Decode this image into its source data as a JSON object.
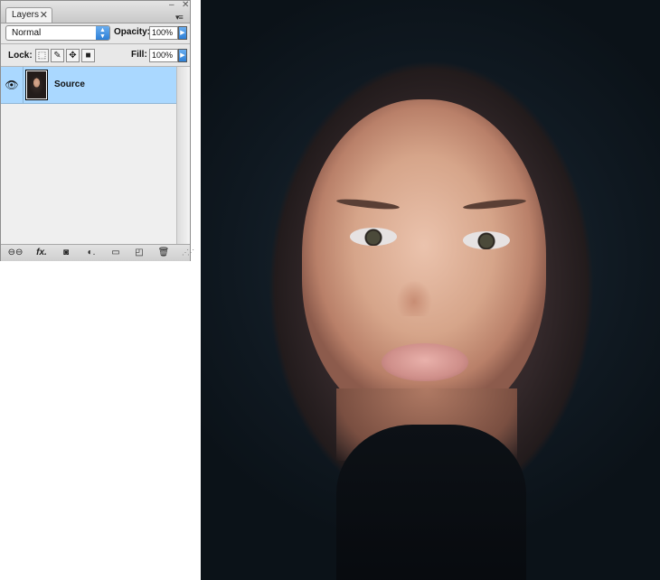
{
  "layers_panel": {
    "tab_label": "Layers",
    "tab_close": "✕",
    "minimize_glyph": "–",
    "close_glyph": "✕",
    "panel_menu_glyph": "▾≡",
    "blend_mode": "Normal",
    "opacity_label": "Opacity:",
    "opacity_value": "100%",
    "lock_label": "Lock:",
    "fill_label": "Fill:",
    "fill_value": "100%",
    "layers": [
      {
        "name": "Source",
        "visible": true,
        "selected": true
      }
    ],
    "footer_buttons": [
      {
        "name": "link-layers-icon",
        "glyph": "⊖⊖"
      },
      {
        "name": "fx-icon",
        "glyph": "fx."
      },
      {
        "name": "add-mask-icon",
        "glyph": "◙"
      },
      {
        "name": "adjustment-layer-icon",
        "glyph": "◐."
      },
      {
        "name": "new-group-icon",
        "glyph": "▭"
      },
      {
        "name": "new-layer-icon",
        "glyph": "◰"
      },
      {
        "name": "delete-layer-icon",
        "glyph": "🗑"
      }
    ]
  },
  "colors": {
    "selected_row": "#aad8ff",
    "accent_blue": "#2d7fd6",
    "canvas_background": "#0f1820"
  }
}
